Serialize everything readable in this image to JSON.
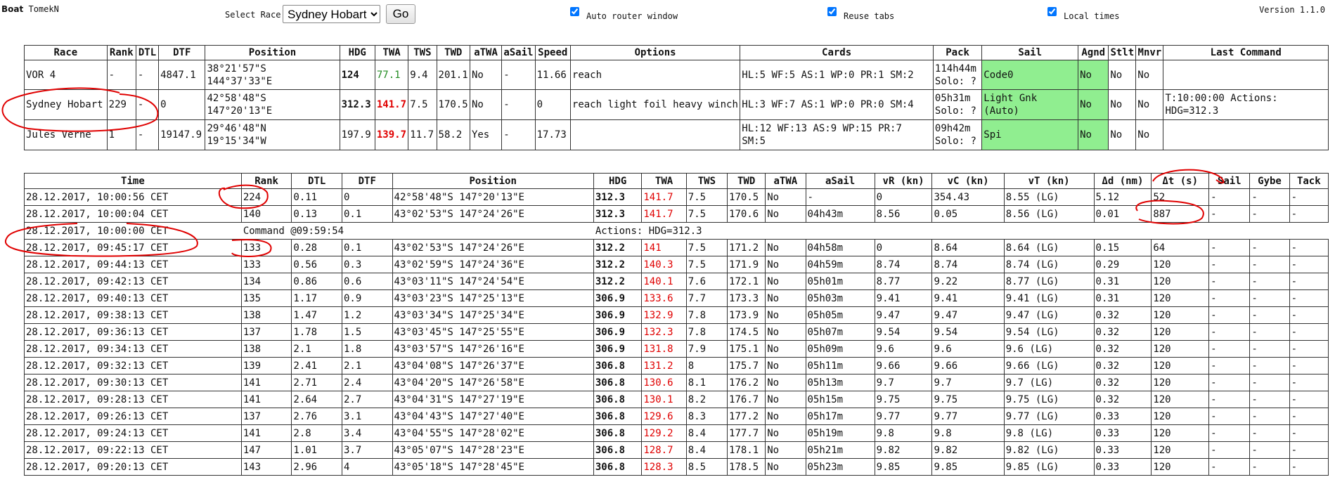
{
  "header": {
    "boat_label": "Boat",
    "boat_name": "TomekN",
    "select_race_label": "Select Race",
    "selected_race": "Sydney Hobart",
    "go_label": "Go",
    "auto_router_label": "Auto router window",
    "reuse_tabs_label": "Reuse tabs",
    "local_times_label": "Local times",
    "version": "Version 1.1.0"
  },
  "races": {
    "columns": [
      "Race",
      "Rank",
      "DTL",
      "DTF",
      "Position",
      "HDG",
      "TWA",
      "TWS",
      "TWD",
      "aTWA",
      "aSail",
      "Speed",
      "Options",
      "Cards",
      "Pack",
      "Sail",
      "Agnd",
      "Stlt",
      "Mnvr",
      "Last Command"
    ],
    "rows": [
      {
        "race": "VOR 4",
        "rank": "-",
        "dtl": "-",
        "dtf": "4847.1",
        "pos1": "38°21'57\"S",
        "pos2": "144°37'33\"E",
        "hdg": "124",
        "twa": "77.1",
        "tws": "9.4",
        "twd": "201.1",
        "atwa": "No",
        "asail": "-",
        "speed": "11.66",
        "options": "reach",
        "cards": "HL:5 WF:5 AS:1 WP:0 PR:1 SM:2",
        "pack1": "114h44m",
        "pack2": "Solo: ?",
        "sail1": "Code0",
        "sail2": "",
        "agnd": "No",
        "stlt": "No",
        "mnvr": "No",
        "last1": "",
        "last2": ""
      },
      {
        "race": "Sydney Hobart",
        "rank": "229",
        "dtl": "-",
        "dtf": "0",
        "pos1": "42°58'48\"S",
        "pos2": "147°20'13\"E",
        "hdg": "312.3",
        "twa": "141.7",
        "tws": "7.5",
        "twd": "170.5",
        "atwa": "No",
        "asail": "-",
        "speed": "0",
        "options": "reach light foil heavy winch",
        "cards": "HL:3 WF:7 AS:1 WP:0 PR:0 SM:4",
        "pack1": "05h31m",
        "pack2": "Solo: ?",
        "sail1": "Light Gnk",
        "sail2": "(Auto)",
        "agnd": "No",
        "stlt": "No",
        "mnvr": "No",
        "last1": "T:10:00:00 Actions:",
        "last2": "HDG=312.3"
      },
      {
        "race": "Jules Verne",
        "rank": "1",
        "dtl": "-",
        "dtf": "19147.9",
        "pos1": "29°46'48\"N",
        "pos2": "19°15'34\"W",
        "hdg": "197.9",
        "twa": "139.7",
        "tws": "11.7",
        "twd": "58.2",
        "atwa": "Yes",
        "asail": "-",
        "speed": "17.73",
        "options": "",
        "cards1": "HL:12 WF:13 AS:9 WP:15 PR:7",
        "cards2": "SM:5",
        "pack1": "09h42m",
        "pack2": "Solo: ?",
        "sail1": "Spi",
        "sail2": "",
        "agnd": "No",
        "stlt": "No",
        "mnvr": "No",
        "last1": "",
        "last2": ""
      }
    ]
  },
  "log": {
    "columns": [
      "Time",
      "Rank",
      "DTL",
      "DTF",
      "Position",
      "HDG",
      "TWA",
      "TWS",
      "TWD",
      "aTWA",
      "aSail",
      "vR (kn)",
      "vC (kn)",
      "vT (kn)",
      "Δd (nm)",
      "Δt (s)",
      "Sail",
      "Gybe",
      "Tack"
    ],
    "command": {
      "time": "28.12.2017, 10:00:00 CET",
      "label": "Command @09:59:54",
      "actions": "Actions: HDG=312.3"
    },
    "rows": [
      [
        "28.12.2017, 10:00:56 CET",
        "224",
        "0.11",
        "0",
        "42°58'48\"S 147°20'13\"E",
        "312.3",
        "141.7",
        "7.5",
        "170.5",
        "No",
        "-",
        "0",
        "354.43",
        "8.55 (LG)",
        "5.12",
        "52",
        "-",
        "-",
        "-"
      ],
      [
        "28.12.2017, 10:00:04 CET",
        "140",
        "0.13",
        "0.1",
        "43°02'53\"S 147°24'26\"E",
        "312.3",
        "141.7",
        "7.5",
        "170.6",
        "No",
        "04h43m",
        "8.56",
        "0.05",
        "8.56 (LG)",
        "0.01",
        "887",
        "-",
        "-",
        "-"
      ],
      [
        "28.12.2017, 09:45:17 CET",
        "133",
        "0.28",
        "0.1",
        "43°02'53\"S 147°24'26\"E",
        "312.2",
        "141",
        "7.5",
        "171.2",
        "No",
        "04h58m",
        "0",
        "8.64",
        "8.64 (LG)",
        "0.15",
        "64",
        "-",
        "-",
        "-"
      ],
      [
        "28.12.2017, 09:44:13 CET",
        "133",
        "0.56",
        "0.3",
        "43°02'59\"S 147°24'36\"E",
        "312.2",
        "140.3",
        "7.5",
        "171.9",
        "No",
        "04h59m",
        "8.74",
        "8.74",
        "8.74 (LG)",
        "0.29",
        "120",
        "-",
        "-",
        "-"
      ],
      [
        "28.12.2017, 09:42:13 CET",
        "134",
        "0.86",
        "0.6",
        "43°03'11\"S 147°24'54\"E",
        "312.2",
        "140.1",
        "7.6",
        "172.1",
        "No",
        "05h01m",
        "8.77",
        "9.22",
        "8.77 (LG)",
        "0.31",
        "120",
        "-",
        "-",
        "-"
      ],
      [
        "28.12.2017, 09:40:13 CET",
        "135",
        "1.17",
        "0.9",
        "43°03'23\"S 147°25'13\"E",
        "306.9",
        "133.6",
        "7.7",
        "173.3",
        "No",
        "05h03m",
        "9.41",
        "9.41",
        "9.41 (LG)",
        "0.31",
        "120",
        "-",
        "-",
        "-"
      ],
      [
        "28.12.2017, 09:38:13 CET",
        "138",
        "1.47",
        "1.2",
        "43°03'34\"S 147°25'34\"E",
        "306.9",
        "132.9",
        "7.8",
        "173.9",
        "No",
        "05h05m",
        "9.47",
        "9.47",
        "9.47 (LG)",
        "0.32",
        "120",
        "-",
        "-",
        "-"
      ],
      [
        "28.12.2017, 09:36:13 CET",
        "137",
        "1.78",
        "1.5",
        "43°03'45\"S 147°25'55\"E",
        "306.9",
        "132.3",
        "7.8",
        "174.5",
        "No",
        "05h07m",
        "9.54",
        "9.54",
        "9.54 (LG)",
        "0.32",
        "120",
        "-",
        "-",
        "-"
      ],
      [
        "28.12.2017, 09:34:13 CET",
        "138",
        "2.1",
        "1.8",
        "43°03'57\"S 147°26'16\"E",
        "306.9",
        "131.8",
        "7.9",
        "175.1",
        "No",
        "05h09m",
        "9.6",
        "9.6",
        "9.6 (LG)",
        "0.32",
        "120",
        "-",
        "-",
        "-"
      ],
      [
        "28.12.2017, 09:32:13 CET",
        "139",
        "2.41",
        "2.1",
        "43°04'08\"S 147°26'37\"E",
        "306.8",
        "131.2",
        "8",
        "175.7",
        "No",
        "05h11m",
        "9.66",
        "9.66",
        "9.66 (LG)",
        "0.32",
        "120",
        "-",
        "-",
        "-"
      ],
      [
        "28.12.2017, 09:30:13 CET",
        "141",
        "2.71",
        "2.4",
        "43°04'20\"S 147°26'58\"E",
        "306.8",
        "130.6",
        "8.1",
        "176.2",
        "No",
        "05h13m",
        "9.7",
        "9.7",
        "9.7 (LG)",
        "0.32",
        "120",
        "-",
        "-",
        "-"
      ],
      [
        "28.12.2017, 09:28:13 CET",
        "141",
        "2.64",
        "2.7",
        "43°04'31\"S 147°27'19\"E",
        "306.8",
        "130.1",
        "8.2",
        "176.7",
        "No",
        "05h15m",
        "9.75",
        "9.75",
        "9.75 (LG)",
        "0.32",
        "120",
        "-",
        "-",
        "-"
      ],
      [
        "28.12.2017, 09:26:13 CET",
        "137",
        "2.76",
        "3.1",
        "43°04'43\"S 147°27'40\"E",
        "306.8",
        "129.6",
        "8.3",
        "177.2",
        "No",
        "05h17m",
        "9.77",
        "9.77",
        "9.77 (LG)",
        "0.33",
        "120",
        "-",
        "-",
        "-"
      ],
      [
        "28.12.2017, 09:24:13 CET",
        "141",
        "2.8",
        "3.4",
        "43°04'55\"S 147°28'02\"E",
        "306.8",
        "129.2",
        "8.4",
        "177.7",
        "No",
        "05h19m",
        "9.8",
        "9.8",
        "9.8 (LG)",
        "0.33",
        "120",
        "-",
        "-",
        "-"
      ],
      [
        "28.12.2017, 09:22:13 CET",
        "147",
        "1.01",
        "3.7",
        "43°05'07\"S 147°28'23\"E",
        "306.8",
        "128.7",
        "8.4",
        "178.1",
        "No",
        "05h21m",
        "9.82",
        "9.82",
        "9.82 (LG)",
        "0.33",
        "120",
        "-",
        "-",
        "-"
      ],
      [
        "28.12.2017, 09:20:13 CET",
        "143",
        "2.96",
        "4",
        "43°05'18\"S 147°28'45\"E",
        "306.8",
        "128.3",
        "8.5",
        "178.5",
        "No",
        "05h23m",
        "9.85",
        "9.85",
        "9.85 (LG)",
        "0.33",
        "120",
        "-",
        "-",
        "-"
      ]
    ]
  },
  "colors": {
    "sail_green": "#90ee90",
    "twa_red": "#e00000",
    "twa_green": "#228b22",
    "annotation_red": "#e00000"
  }
}
